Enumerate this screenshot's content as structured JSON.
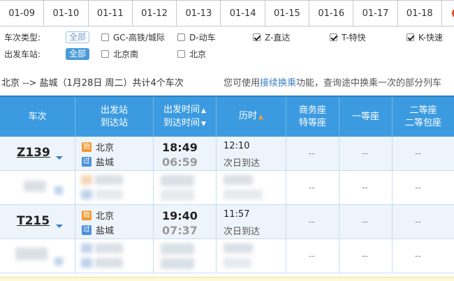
{
  "dates": [
    "01-09",
    "01-10",
    "01-11",
    "01-12",
    "01-13",
    "01-14",
    "01-15",
    "01-16",
    "01-17",
    "01-18"
  ],
  "filters": {
    "type_label": "车次类型:",
    "type_all": "全部",
    "type_options": [
      {
        "label": "GC-高铁/城际",
        "checked": false
      },
      {
        "label": "D-动车",
        "checked": false
      },
      {
        "label": "Z-直达",
        "checked": true
      },
      {
        "label": "T-特快",
        "checked": true
      },
      {
        "label": "K-快速",
        "checked": true
      }
    ],
    "station_label": "出发车站:",
    "station_all": "全部",
    "station_options": [
      {
        "label": "北京南",
        "checked": false
      },
      {
        "label": "北京",
        "checked": false
      }
    ]
  },
  "summary": {
    "route": "北京 --> 盐城（1月28日  周二）共计",
    "count": "4",
    "suffix": "个车次",
    "hint_prefix": "您可使用",
    "hint_link": "接续换乘",
    "hint_suffix": "功能，查询途中换乘一次的部分列车"
  },
  "table": {
    "headers": {
      "train": "车次",
      "station_top": "出发站",
      "station_bottom": "到达站",
      "time_top": "出发时间",
      "time_bottom": "到达时间",
      "duration": "历时",
      "business_top": "商务座",
      "business_bottom": "特等座",
      "first": "一等座",
      "second_top": "二等座",
      "second_bottom": "二等包座"
    },
    "rows": [
      {
        "train_no": "Z139",
        "from_badge": "始",
        "from": "北京",
        "to_badge": "过",
        "to": "盐城",
        "depart": "18:49",
        "arrive": "06:59",
        "duration": "12:10",
        "arrive_note": "次日到达",
        "seats": [
          "--",
          "--",
          "--"
        ]
      },
      {
        "blurred": true,
        "seats": [
          "--",
          "--",
          "--"
        ]
      },
      {
        "train_no": "T215",
        "from_badge": "始",
        "from": "北京",
        "to_badge": "过",
        "to": "盐城",
        "depart": "19:40",
        "arrive": "07:37",
        "duration": "11:57",
        "arrive_note": "次日到达",
        "seats": [
          "--",
          "--",
          "--"
        ]
      },
      {
        "blurred": true,
        "seats": [
          "--",
          "--",
          "--"
        ]
      }
    ]
  },
  "colors": {
    "header_blue": "#3c9be0",
    "link_blue": "#3a7fc6",
    "badge_start": "#f09b35",
    "badge_pass": "#4a90d9",
    "sort_orange": "#ff9e3d"
  }
}
